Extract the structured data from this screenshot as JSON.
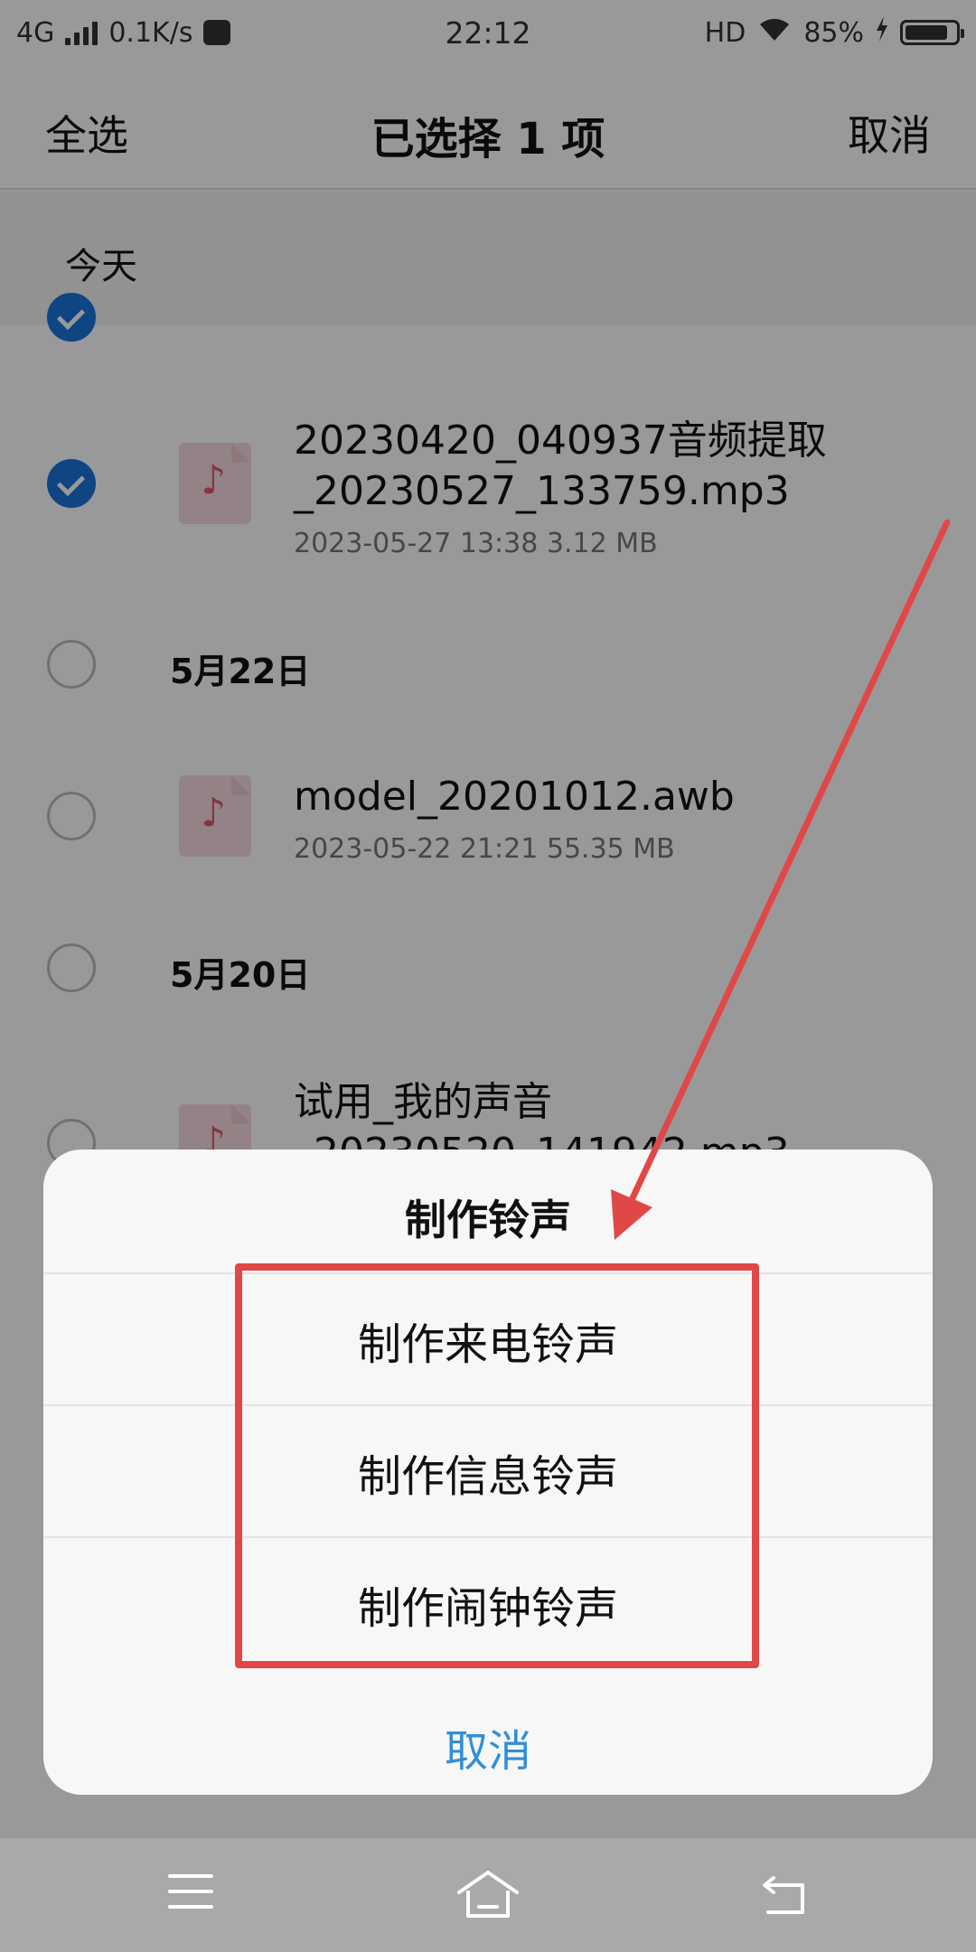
{
  "status_bar": {
    "network": "4G",
    "speed": "0.1K/s",
    "time": "22:12",
    "hd": "HD",
    "battery": "85%",
    "battery_level": 0.85
  },
  "header": {
    "select_all": "全选",
    "title": "已选择 1 项",
    "cancel": "取消"
  },
  "sections": {
    "today": "今天"
  },
  "files": [
    {
      "name_line1": "20230420_040937音频提取",
      "name_line2": "_20230527_133759.mp3",
      "meta": "2023-05-27 13:38   3.12 MB",
      "checked": true
    },
    {
      "date": "5月22日"
    },
    {
      "name_line1": "model_20201012.awb",
      "meta": "2023-05-22 21:21   55.35 MB",
      "checked": false
    },
    {
      "date": "5月20日"
    },
    {
      "name_line1": "试用_我的声音",
      "name_line2": "_20230520_141942.mp3",
      "checked": false
    }
  ],
  "sheet": {
    "title": "制作铃声",
    "items": [
      "制作来电铃声",
      "制作信息铃声",
      "制作闹钟铃声"
    ],
    "cancel": "取消"
  },
  "annotation": {
    "color": "#e04848"
  },
  "nav": {
    "icons": [
      "menu-icon",
      "home-icon",
      "back-icon"
    ]
  }
}
